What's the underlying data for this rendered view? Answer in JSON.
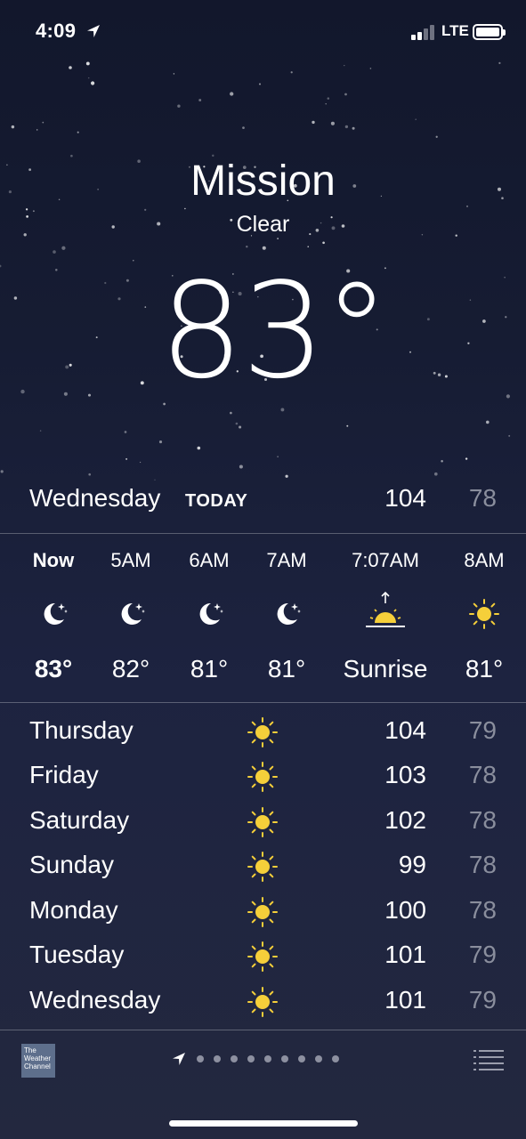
{
  "status_bar": {
    "time": "4:09",
    "network": "LTE"
  },
  "header": {
    "city": "Mission",
    "condition": "Clear",
    "temperature": "83°"
  },
  "today": {
    "day": "Wednesday",
    "label": "TODAY",
    "high": "104",
    "low": "78"
  },
  "hourly": [
    {
      "time": "Now",
      "icon": "moon-stars-icon",
      "temp": "83°"
    },
    {
      "time": "5AM",
      "icon": "moon-stars-icon",
      "temp": "82°"
    },
    {
      "time": "6AM",
      "icon": "moon-stars-icon",
      "temp": "81°"
    },
    {
      "time": "7AM",
      "icon": "moon-stars-icon",
      "temp": "81°"
    },
    {
      "time": "7:07AM",
      "icon": "sunrise-icon",
      "temp": "Sunrise"
    },
    {
      "time": "8AM",
      "icon": "sun-icon",
      "temp": "81°"
    }
  ],
  "daily": [
    {
      "day": "Thursday",
      "icon": "sun-icon",
      "high": "104",
      "low": "79"
    },
    {
      "day": "Friday",
      "icon": "sun-icon",
      "high": "103",
      "low": "78"
    },
    {
      "day": "Saturday",
      "icon": "sun-icon",
      "high": "102",
      "low": "78"
    },
    {
      "day": "Sunday",
      "icon": "sun-icon",
      "high": "99",
      "low": "78"
    },
    {
      "day": "Monday",
      "icon": "sun-icon",
      "high": "100",
      "low": "78"
    },
    {
      "day": "Tuesday",
      "icon": "sun-icon",
      "high": "101",
      "low": "79"
    },
    {
      "day": "Wednesday",
      "icon": "sun-icon",
      "high": "101",
      "low": "79"
    }
  ],
  "footer": {
    "logo_text": "The Weather Channel",
    "page_count": 10,
    "current_page": "location"
  },
  "colors": {
    "sun": "#f5cf3a",
    "low_temp": "#8a8e9d",
    "background_top": "#12172c",
    "background_bottom": "#23283f"
  }
}
